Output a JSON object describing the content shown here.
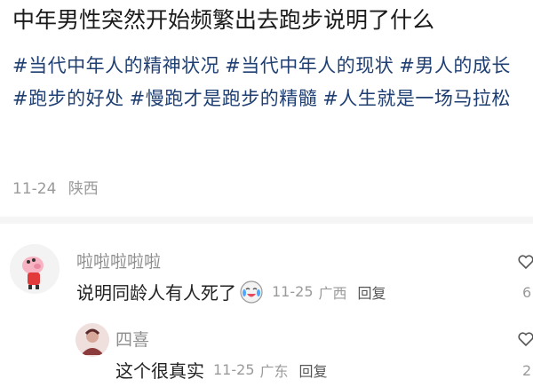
{
  "post": {
    "title": "中年男性突然开始频繁出去跑步说明了什么",
    "tags": [
      "#当代中年人的精神状况",
      "#当代中年人的现状",
      "#男人的成长",
      "#跑步的好处",
      "#慢跑才是跑步的精髓",
      "#人生就是一场马拉松"
    ],
    "date": "11-24",
    "location": "陕西"
  },
  "comments": [
    {
      "user": "啦啦啦啦啦",
      "text": "说明同龄人有人死了",
      "emoji": "crying-laughing-emoji",
      "time": "11-25",
      "location": "广西",
      "reply_label": "回复",
      "likes": "6"
    },
    {
      "user": "四喜",
      "text": "这个很真实",
      "time": "11-25",
      "location": "广东",
      "reply_label": "回复",
      "likes": "2"
    }
  ],
  "icons": {
    "like": "heart-like-icon",
    "avatar_1": "pig-avatar-icon",
    "avatar_2": "portrait-avatar-icon"
  },
  "colors": {
    "tag": "#1f3f73",
    "meta": "#9a9a9a",
    "text": "#222222"
  }
}
